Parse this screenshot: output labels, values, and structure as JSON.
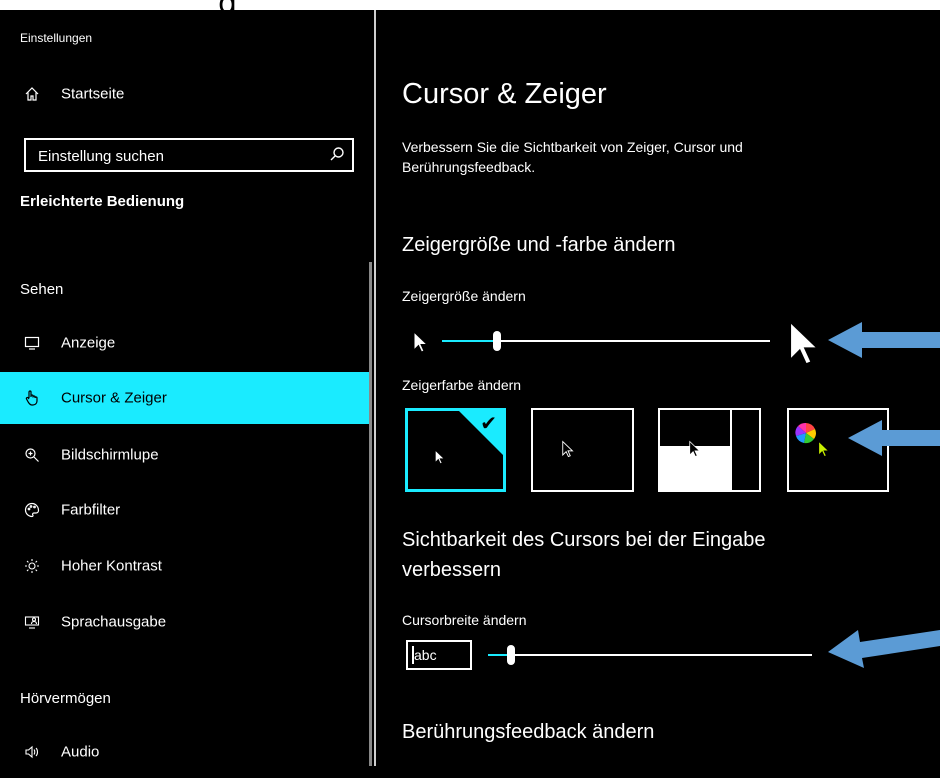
{
  "app_title": "Einstellungen",
  "sidebar": {
    "home_label": "Startseite",
    "search_placeholder": "Einstellung suchen",
    "category_title": "Erleichterte Bedienung",
    "section_sehen": "Sehen",
    "section_hoeren": "Hörvermögen",
    "items": [
      {
        "label": "Anzeige",
        "icon": "monitor-icon"
      },
      {
        "label": "Cursor & Zeiger",
        "icon": "hand-pointer-icon",
        "active": true
      },
      {
        "label": "Bildschirmlupe",
        "icon": "magnifier-plus-icon"
      },
      {
        "label": "Farbfilter",
        "icon": "palette-icon"
      },
      {
        "label": "Hoher Kontrast",
        "icon": "sun-icon"
      },
      {
        "label": "Sprachausgabe",
        "icon": "narrator-icon"
      },
      {
        "label": "Audio",
        "icon": "speaker-icon"
      }
    ]
  },
  "main": {
    "title": "Cursor & Zeiger",
    "description": "Verbessern Sie die Sichtbarkeit von Zeiger, Cursor und Berührungsfeedback.",
    "pointer_section": {
      "heading": "Zeigergröße und -farbe ändern",
      "size_label": "Zeigergröße ändern",
      "size_value_fraction": 0.16,
      "color_label": "Zeigerfarbe ändern",
      "color_options": [
        "white",
        "black",
        "inverted",
        "custom"
      ],
      "selected_color": "white"
    },
    "cursor_section": {
      "heading": "Sichtbarkeit des Cursors bei der Eingabe verbessern",
      "width_label": "Cursorbreite ändern",
      "preview_text": "abc",
      "width_value_fraction": 0.06
    },
    "touch_section": {
      "heading": "Berührungsfeedback ändern"
    }
  },
  "colors": {
    "accent": "#1aebff",
    "annotation_arrow": "#5b9bd5",
    "background": "#000000",
    "foreground": "#ffffff"
  }
}
